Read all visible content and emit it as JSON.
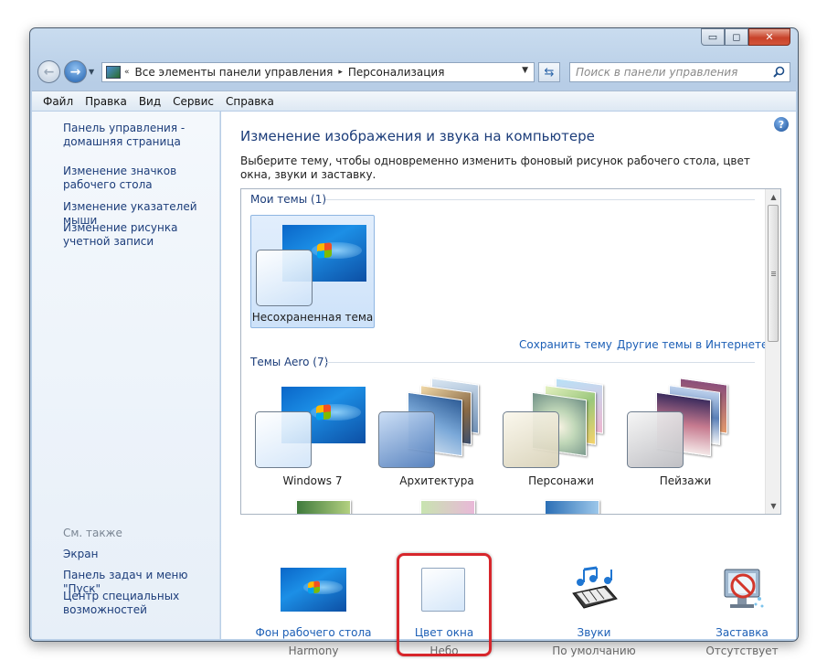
{
  "window": {
    "controls": {
      "minimize": "▭",
      "maximize": "◻",
      "close": "✕"
    }
  },
  "address_bar": {
    "segments": [
      "Все элементы панели управления",
      "Персонализация"
    ],
    "lead_sep": "«",
    "sep": "▸",
    "search_placeholder": "Поиск в панели управления"
  },
  "menu": [
    "Файл",
    "Правка",
    "Вид",
    "Сервис",
    "Справка"
  ],
  "sidebar": {
    "links": [
      "Панель управления - домашняя страница",
      "Изменение значков рабочего стола",
      "Изменение указателей мыши",
      "Изменение рисунка учетной записи"
    ],
    "see_also_heading": "См. также",
    "see_also": [
      "Экран",
      "Панель задач и меню \"Пуск\"",
      "Центр специальных возможностей"
    ]
  },
  "main": {
    "title": "Изменение изображения и звука на компьютере",
    "description": "Выберите тему, чтобы одновременно изменить фоновый рисунок рабочего стола, цвет окна, звуки и заставку.",
    "my_themes_heading": "Мои темы (1)",
    "my_themes": [
      {
        "label": "Несохраненная тема",
        "selected": true
      }
    ],
    "save_theme_link": "Сохранить тему",
    "online_themes_link": "Другие темы в Интернете",
    "aero_heading": "Темы Aero (7)",
    "aero_themes": [
      "Windows 7",
      "Архитектура",
      "Персонажи",
      "Пейзажи"
    ]
  },
  "options": [
    {
      "title": "Фон рабочего стола",
      "value": "Harmony",
      "icon": "wallpaper-icon"
    },
    {
      "title": "Цвет окна",
      "value": "Небо",
      "icon": "window-color-icon",
      "highlighted": true
    },
    {
      "title": "Звуки",
      "value": "По умолчанию",
      "icon": "sounds-icon"
    },
    {
      "title": "Заставка",
      "value": "Отсутствует",
      "icon": "screensaver-icon"
    }
  ],
  "colors": {
    "link": "#1c5fb6",
    "heading": "#1c3d7a",
    "highlight_border": "#d7262c"
  }
}
